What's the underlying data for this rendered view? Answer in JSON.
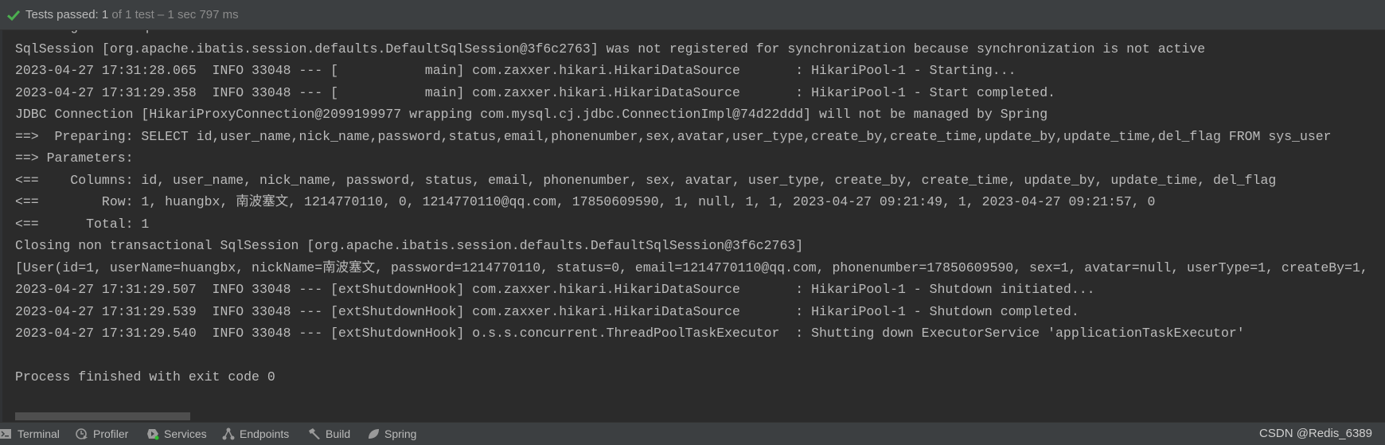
{
  "header": {
    "status_main": "Tests passed: 1",
    "status_sub": " of 1 test – 1 sec 797 ms",
    "status_icon": "check-icon",
    "accent": "#4caf50"
  },
  "console": {
    "lines": [
      "Creating a new SqlSession",
      "SqlSession [org.apache.ibatis.session.defaults.DefaultSqlSession@3f6c2763] was not registered for synchronization because synchronization is not active",
      "2023-04-27 17:31:28.065  INFO 33048 --- [           main] com.zaxxer.hikari.HikariDataSource       : HikariPool-1 - Starting...",
      "2023-04-27 17:31:29.358  INFO 33048 --- [           main] com.zaxxer.hikari.HikariDataSource       : HikariPool-1 - Start completed.",
      "JDBC Connection [HikariProxyConnection@2099199977 wrapping com.mysql.cj.jdbc.ConnectionImpl@74d22ddd] will not be managed by Spring",
      "==>  Preparing: SELECT id,user_name,nick_name,password,status,email,phonenumber,sex,avatar,user_type,create_by,create_time,update_by,update_time,del_flag FROM sys_user",
      "==> Parameters: ",
      "<==    Columns: id, user_name, nick_name, password, status, email, phonenumber, sex, avatar, user_type, create_by, create_time, update_by, update_time, del_flag",
      "<==        Row: 1, huangbx, 南波塞文, 1214770110, 0, 1214770110@qq.com, 17850609590, 1, null, 1, 1, 2023-04-27 09:21:49, 1, 2023-04-27 09:21:57, 0",
      "<==      Total: 1",
      "Closing non transactional SqlSession [org.apache.ibatis.session.defaults.DefaultSqlSession@3f6c2763]",
      "[User(id=1, userName=huangbx, nickName=南波塞文, password=1214770110, status=0, email=1214770110@qq.com, phonenumber=17850609590, sex=1, avatar=null, userType=1, createBy=1,",
      "2023-04-27 17:31:29.507  INFO 33048 --- [extShutdownHook] com.zaxxer.hikari.HikariDataSource       : HikariPool-1 - Shutdown initiated...",
      "2023-04-27 17:31:29.539  INFO 33048 --- [extShutdownHook] com.zaxxer.hikari.HikariDataSource       : HikariPool-1 - Shutdown completed.",
      "2023-04-27 17:31:29.540  INFO 33048 --- [extShutdownHook] o.s.s.concurrent.ThreadPoolTaskExecutor  : Shutting down ExecutorService 'applicationTaskExecutor'",
      "",
      "Process finished with exit code 0"
    ]
  },
  "toolbar": {
    "tabs": [
      {
        "label": "Terminal",
        "icon": "terminal-icon"
      },
      {
        "label": "Profiler",
        "icon": "profiler-icon"
      },
      {
        "label": "Services",
        "icon": "services-icon"
      },
      {
        "label": "Endpoints",
        "icon": "endpoints-icon"
      },
      {
        "label": "Build",
        "icon": "build-hammer-icon"
      },
      {
        "label": "Spring",
        "icon": "spring-leaf-icon"
      }
    ]
  },
  "watermark": "CSDN @Redis_6389"
}
